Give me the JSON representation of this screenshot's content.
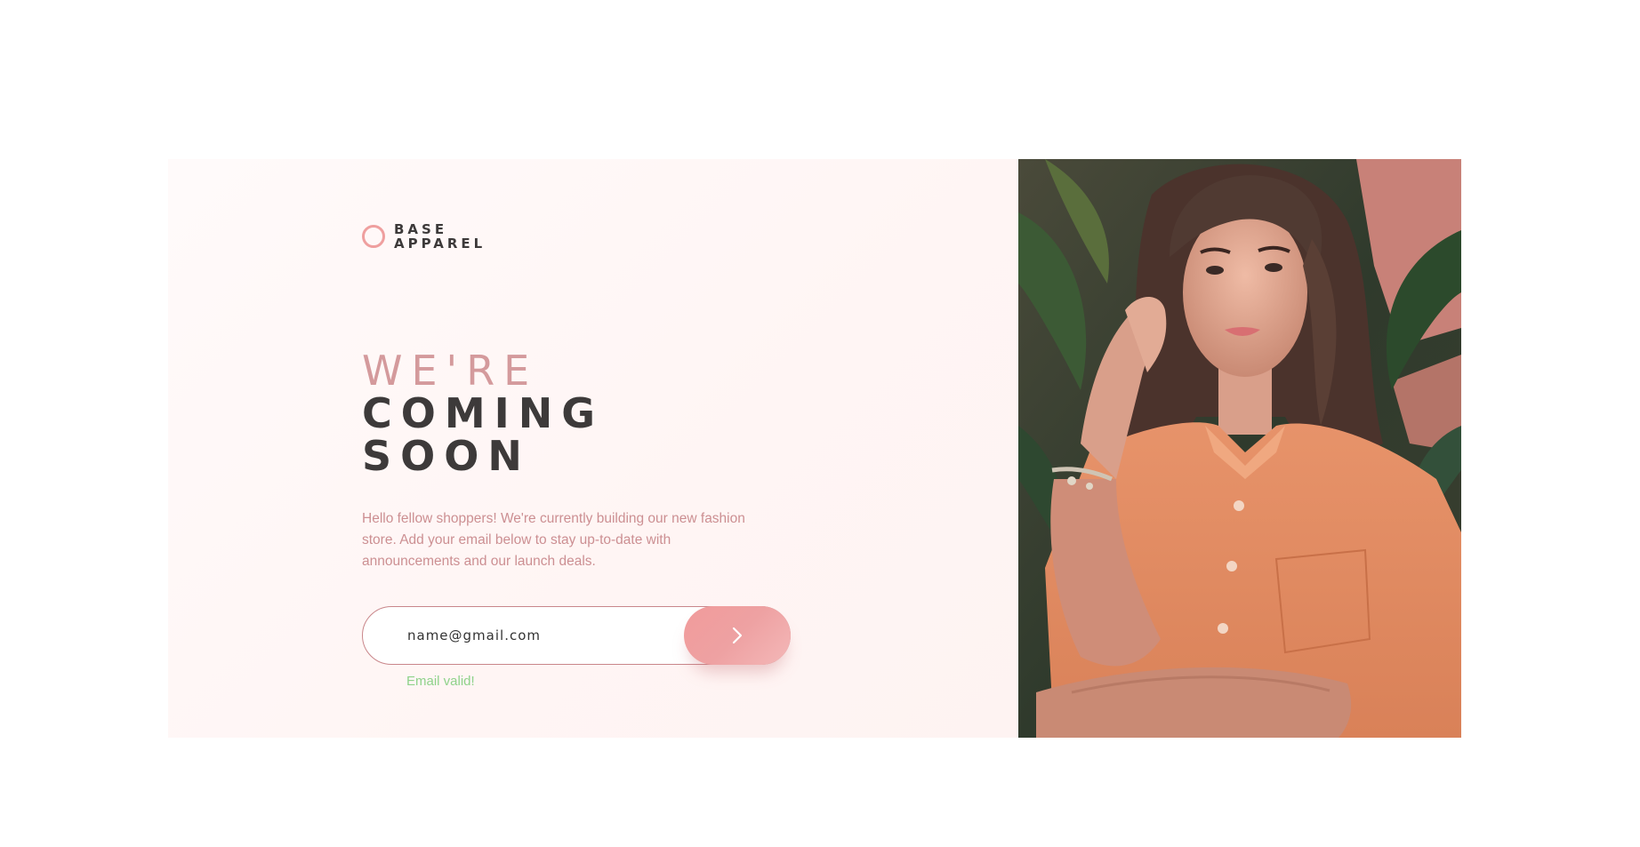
{
  "brand": {
    "line1": "BASE",
    "line2": "APPAREL"
  },
  "headline": {
    "line1": "WE'RE",
    "line2": "COMING",
    "line3": "SOON"
  },
  "description": "Hello fellow shoppers! We're currently building our new fashion store. Add your email below to stay up-to-date with announcements and our launch deals.",
  "form": {
    "email_value": "name@gmail.com",
    "submit_icon": "chevron-right-icon",
    "validation_message": "Email valid!"
  },
  "colors": {
    "accent": "#ef9f9f",
    "text_dark": "#3d3a3a",
    "text_muted": "#cc8f92",
    "success": "#8fd28a"
  }
}
